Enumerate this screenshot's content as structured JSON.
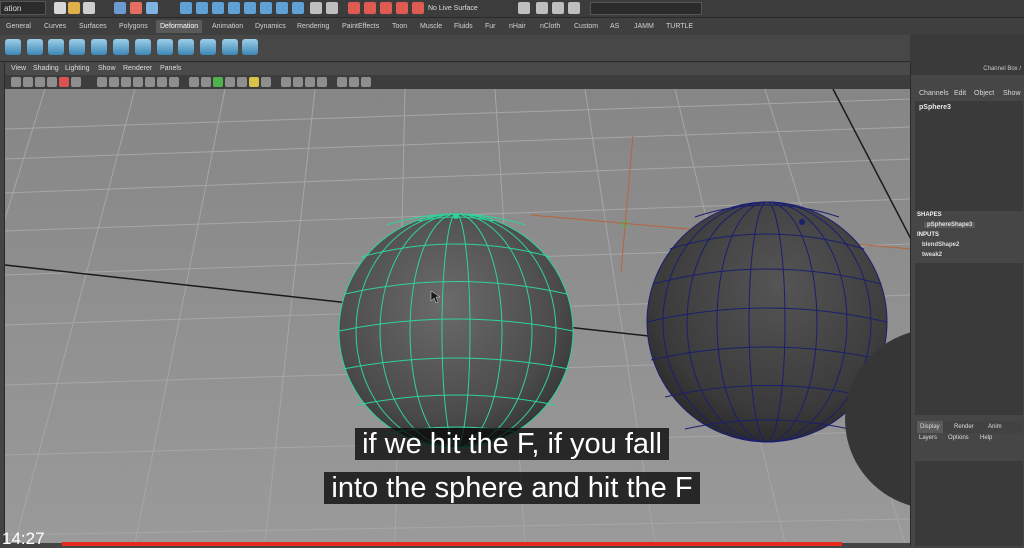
{
  "status_line": {
    "mode": "ation",
    "live_surface": "No Live Surface"
  },
  "shelf": {
    "tabs": [
      "General",
      "Curves",
      "Surfaces",
      "Polygons",
      "Deformation",
      "Animation",
      "Dynamics",
      "Rendering",
      "PaintEffects",
      "Toon",
      "Muscle",
      "Fluids",
      "Fur",
      "nHair",
      "nCloth",
      "Custom",
      "AS",
      "JAMM",
      "TURTLE"
    ],
    "active_tab": "Deformation"
  },
  "viewport": {
    "menu": [
      "View",
      "Shading",
      "Lighting",
      "Show",
      "Renderer",
      "Panels"
    ]
  },
  "channel_box": {
    "title": "Channel Box /",
    "menu": [
      "Channels",
      "Edit",
      "Object",
      "Show"
    ],
    "object": "pSphere3",
    "shapes_header": "SHAPES",
    "shape_node": "pSphereShape3",
    "inputs_header": "INPUTS",
    "input_nodes": [
      "blendShape2",
      "tweak2"
    ],
    "layer_tabs": [
      "Display",
      "Render",
      "Anim"
    ],
    "layer_menu": [
      "Layers",
      "Options",
      "Help"
    ]
  },
  "caption": {
    "line1": "if we hit the F, if you fall",
    "line2": "into the sphere and hit the F"
  },
  "video": {
    "time": "14:27",
    "progress_color": "#e42b1e"
  },
  "colors": {
    "wireframe_selected": "#2fd39a",
    "wireframe_unselected": "#1a1f6e"
  }
}
